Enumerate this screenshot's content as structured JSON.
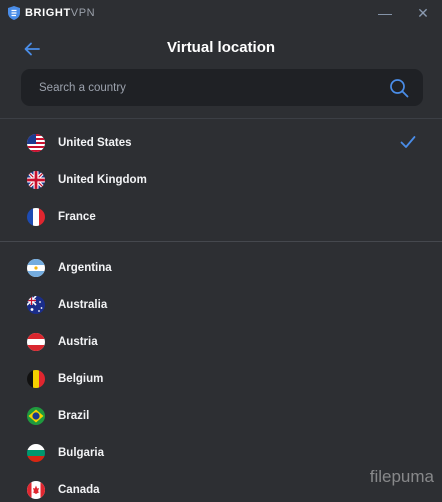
{
  "titlebar": {
    "brand_bold": "BRIGHT",
    "brand_light": "VPN",
    "minimize": "—",
    "close": "✕"
  },
  "header": {
    "title": "Virtual location"
  },
  "search": {
    "placeholder": "Search a country"
  },
  "countries_recent": [
    {
      "name": "United States",
      "selected": true
    },
    {
      "name": "United Kingdom",
      "selected": false
    },
    {
      "name": "France",
      "selected": false
    }
  ],
  "countries_all": [
    {
      "name": "Argentina"
    },
    {
      "name": "Australia"
    },
    {
      "name": "Austria"
    },
    {
      "name": "Belgium"
    },
    {
      "name": "Brazil"
    },
    {
      "name": "Bulgaria"
    },
    {
      "name": "Canada"
    }
  ],
  "watermark": "filepuma",
  "colors": {
    "accent": "#4a8de8",
    "background": "#2d2f33",
    "search_bg": "#1f2125"
  }
}
